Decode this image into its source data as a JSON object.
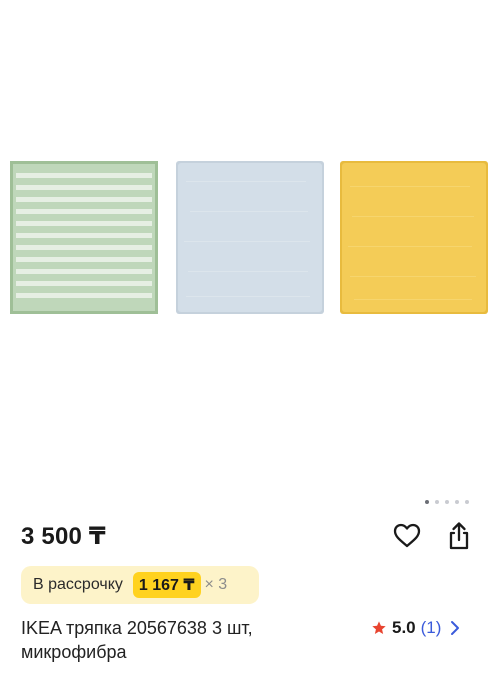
{
  "gallery": {
    "images": [
      {
        "name": "green-striped-cloth",
        "colors": {
          "base": "#bfd7ba",
          "stripe": "#e6efe3",
          "border": "#9fbf97"
        }
      },
      {
        "name": "light-blue-cloth",
        "colors": {
          "base": "#d3dee8",
          "border": "#c5d1dc"
        }
      },
      {
        "name": "yellow-cloth",
        "colors": {
          "base": "#f4cc57",
          "border": "#e8bb3e"
        }
      }
    ],
    "page_count": 5,
    "active_page": 1
  },
  "product": {
    "price": "3 500 ₸",
    "title": "IKEA тряпка 20567638 3 шт, микрофибра",
    "installment": {
      "label": "В рассрочку",
      "amount": "1 167 ₸",
      "multiplier": "× 3"
    },
    "rating": {
      "value": "5.0",
      "count": "(1)",
      "star_color": "#e8442f"
    }
  },
  "icons": {
    "favorite": "heart-outline-icon",
    "share": "share-icon",
    "rating_star": "star-icon",
    "rating_arrow": "chevron-right-icon"
  }
}
